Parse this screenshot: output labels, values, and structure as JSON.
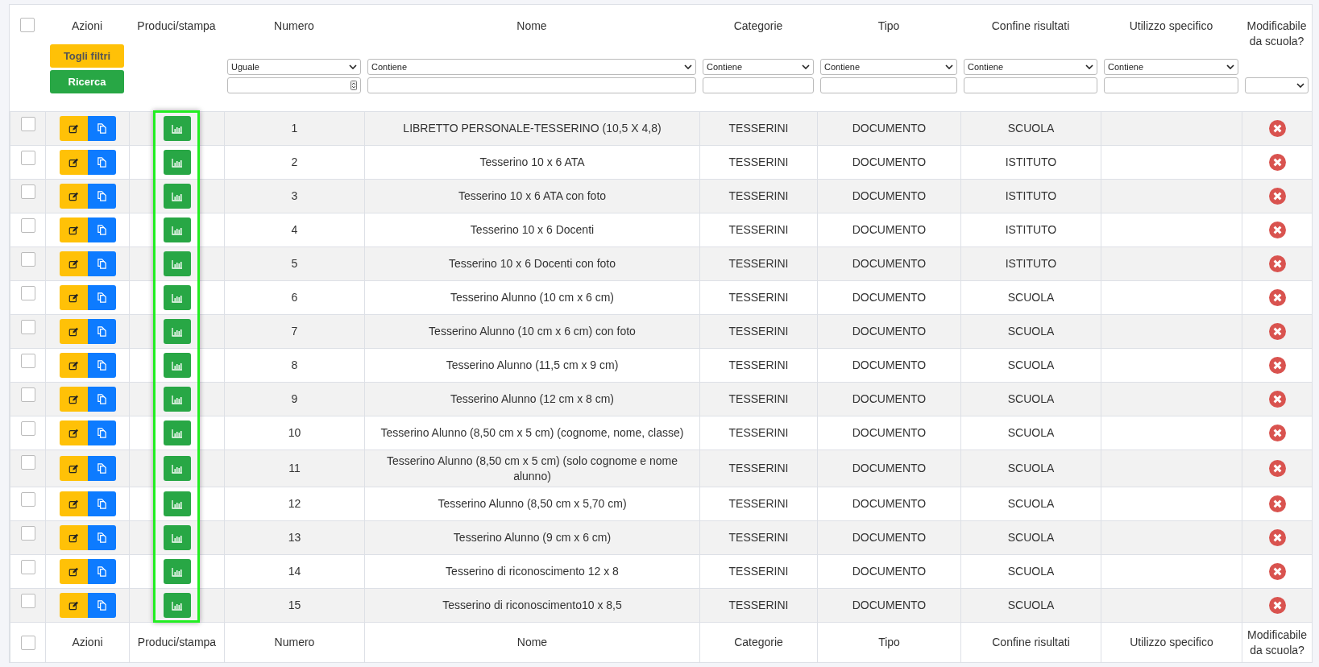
{
  "columns": [
    {
      "kind": "checkbox",
      "checked": false
    },
    {
      "kind": "text",
      "label": "Azioni",
      "highlighted": false,
      "filter": {
        "kind": "buttons",
        "buttons": [
          {
            "label": "Togli filtri",
            "kind": "warning"
          },
          {
            "label": "Ricerca",
            "kind": "success"
          }
        ]
      }
    },
    {
      "kind": "text",
      "label": "Produci/stampa",
      "highlighted": true
    },
    {
      "kind": "text",
      "label": "Numero",
      "highlighted": false,
      "filter": {
        "kind": "number",
        "operator": "Uguale"
      }
    },
    {
      "kind": "text",
      "label": "Nome",
      "highlighted": false,
      "filter": {
        "kind": "text",
        "operator": "Contiene"
      }
    },
    {
      "kind": "text",
      "label": "Categorie",
      "highlighted": false,
      "filter": {
        "kind": "text",
        "operator": "Contiene"
      }
    },
    {
      "kind": "text",
      "label": "Tipo",
      "highlighted": false,
      "filter": {
        "kind": "text",
        "operator": "Contiene"
      }
    },
    {
      "kind": "text",
      "label": "Confine risultati",
      "highlighted": false,
      "filter": {
        "kind": "text",
        "operator": "Contiene"
      }
    },
    {
      "kind": "text",
      "label": "Utilizzo specifico",
      "highlighted": false,
      "filter": {
        "kind": "text",
        "operator": "Contiene"
      }
    },
    {
      "kind": "text",
      "label": "Modificabile da scuola?",
      "highlighted": false,
      "filter": {
        "kind": "select"
      }
    }
  ],
  "rows": [
    {
      "checked": false,
      "numero": "1",
      "nome": "LIBRETTO PERSONALE-TESSERINO (10,5 X 4,8)",
      "categorie": "TESSERINI",
      "tipo": "DOCUMENTO",
      "confine": "SCUOLA",
      "modificabile": false
    },
    {
      "checked": false,
      "numero": "2",
      "nome": "Tesserino 10 x 6 ATA",
      "categorie": "TESSERINI",
      "tipo": "DOCUMENTO",
      "confine": "ISTITUTO",
      "modificabile": false
    },
    {
      "checked": false,
      "numero": "3",
      "nome": "Tesserino 10 x 6 ATA con foto",
      "categorie": "TESSERINI",
      "tipo": "DOCUMENTO",
      "confine": "ISTITUTO",
      "modificabile": false
    },
    {
      "checked": false,
      "numero": "4",
      "nome": "Tesserino 10 x 6 Docenti",
      "categorie": "TESSERINI",
      "tipo": "DOCUMENTO",
      "confine": "ISTITUTO",
      "modificabile": false
    },
    {
      "checked": false,
      "numero": "5",
      "nome": "Tesserino 10 x 6 Docenti con foto",
      "categorie": "TESSERINI",
      "tipo": "DOCUMENTO",
      "confine": "ISTITUTO",
      "modificabile": false
    },
    {
      "checked": false,
      "numero": "6",
      "nome": "Tesserino Alunno (10 cm x 6 cm)",
      "categorie": "TESSERINI",
      "tipo": "DOCUMENTO",
      "confine": "SCUOLA",
      "modificabile": false
    },
    {
      "checked": false,
      "numero": "7",
      "nome": "Tesserino Alunno (10 cm x 6 cm) con foto",
      "categorie": "TESSERINI",
      "tipo": "DOCUMENTO",
      "confine": "SCUOLA",
      "modificabile": false
    },
    {
      "checked": false,
      "numero": "8",
      "nome": "Tesserino Alunno (11,5 cm x 9 cm)",
      "categorie": "TESSERINI",
      "tipo": "DOCUMENTO",
      "confine": "SCUOLA",
      "modificabile": false
    },
    {
      "checked": false,
      "numero": "9",
      "nome": "Tesserino Alunno (12 cm x 8 cm)",
      "categorie": "TESSERINI",
      "tipo": "DOCUMENTO",
      "confine": "SCUOLA",
      "modificabile": false
    },
    {
      "checked": false,
      "numero": "10",
      "nome": "Tesserino Alunno (8,50 cm x 5 cm) (cognome, nome, classe)",
      "categorie": "TESSERINI",
      "tipo": "DOCUMENTO",
      "confine": "SCUOLA",
      "modificabile": false
    },
    {
      "checked": false,
      "numero": "11",
      "nome": "Tesserino Alunno (8,50 cm x 5 cm) (solo cognome e nome alunno)",
      "categorie": "TESSERINI",
      "tipo": "DOCUMENTO",
      "confine": "SCUOLA",
      "modificabile": false
    },
    {
      "checked": false,
      "numero": "12",
      "nome": "Tesserino Alunno (8,50 cm x 5,70 cm)",
      "categorie": "TESSERINI",
      "tipo": "DOCUMENTO",
      "confine": "SCUOLA",
      "modificabile": false
    },
    {
      "checked": false,
      "numero": "13",
      "nome": "Tesserino Alunno (9 cm x 6 cm)",
      "categorie": "TESSERINI",
      "tipo": "DOCUMENTO",
      "confine": "SCUOLA",
      "modificabile": false
    },
    {
      "checked": false,
      "numero": "14",
      "nome": "Tesserino di riconoscimento 12 x 8",
      "categorie": "TESSERINI",
      "tipo": "DOCUMENTO",
      "confine": "SCUOLA",
      "modificabile": false
    },
    {
      "checked": false,
      "numero": "15",
      "nome": "Tesserino di riconoscimento10 x 8,5",
      "categorie": "TESSERINI",
      "tipo": "DOCUMENTO",
      "confine": "SCUOLA",
      "modificabile": false
    }
  ],
  "footer": {
    "checked": false,
    "labels": [
      "Azioni",
      "Produci/stampa",
      "Numero",
      "Nome",
      "Categorie",
      "Tipo",
      "Confine risultati",
      "Utilizzo specifico",
      "Modificabile da scuola?"
    ]
  }
}
